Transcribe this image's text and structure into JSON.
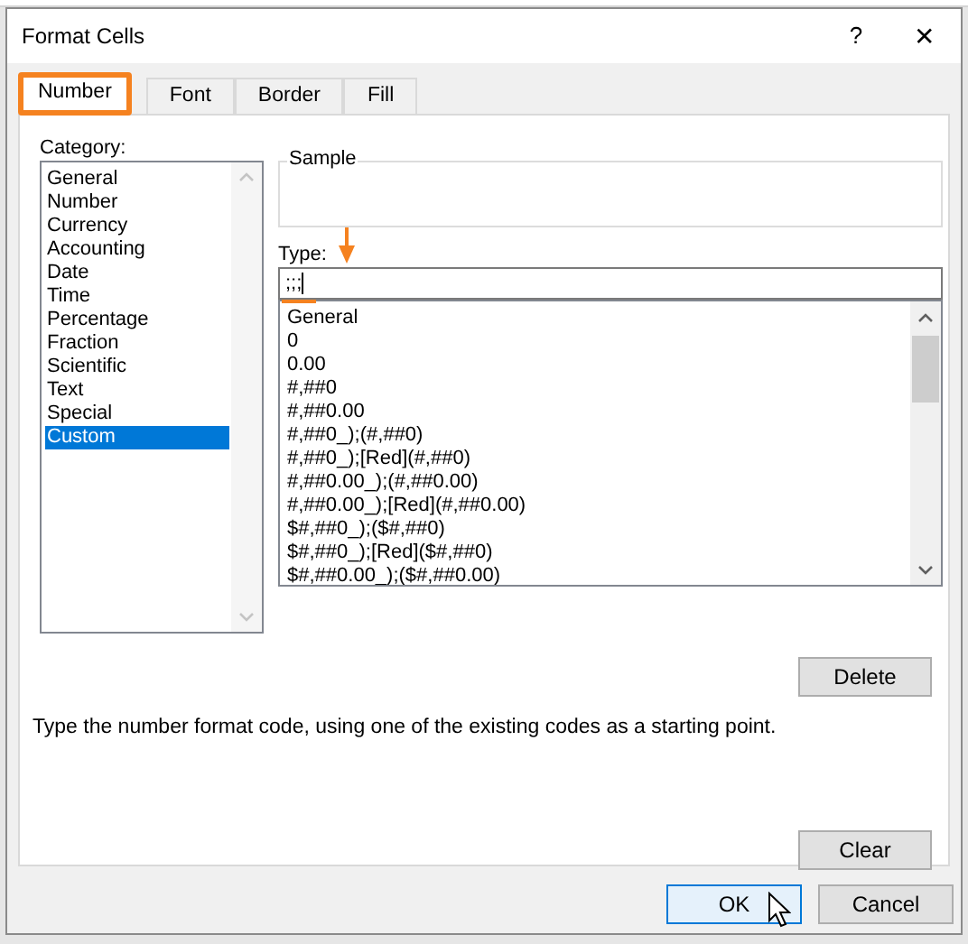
{
  "window": {
    "title": "Format Cells",
    "help": "?",
    "close": "✕"
  },
  "tabs": [
    {
      "label": "Number",
      "selected": true,
      "highlighted": true
    },
    {
      "label": "Font",
      "selected": false,
      "highlighted": false
    },
    {
      "label": "Border",
      "selected": false,
      "highlighted": false
    },
    {
      "label": "Fill",
      "selected": false,
      "highlighted": false
    }
  ],
  "category": {
    "label": "Category:",
    "items": [
      {
        "label": "General",
        "selected": false
      },
      {
        "label": "Number",
        "selected": false
      },
      {
        "label": "Currency",
        "selected": false
      },
      {
        "label": "Accounting",
        "selected": false
      },
      {
        "label": "Date",
        "selected": false
      },
      {
        "label": "Time",
        "selected": false
      },
      {
        "label": "Percentage",
        "selected": false
      },
      {
        "label": "Fraction",
        "selected": false
      },
      {
        "label": "Scientific",
        "selected": false
      },
      {
        "label": "Text",
        "selected": false
      },
      {
        "label": "Special",
        "selected": false
      },
      {
        "label": "Custom",
        "selected": true
      }
    ]
  },
  "sample": {
    "label": "Sample"
  },
  "type": {
    "label": "Type:",
    "value": ";;;",
    "items": [
      "General",
      "0",
      "0.00",
      "#,##0",
      "#,##0.00",
      "#,##0_);(#,##0)",
      "#,##0_);[Red](#,##0)",
      "#,##0.00_);(#,##0.00)",
      "#,##0.00_);[Red](#,##0.00)",
      "$#,##0_);($#,##0)",
      "$#,##0_);[Red]($#,##0)",
      "$#,##0.00_);($#,##0.00)"
    ]
  },
  "delete_button": "Delete",
  "description": "Type the number format code, using one of the existing codes as a starting point.",
  "clear_button": "Clear",
  "buttons": [
    {
      "label": "OK",
      "default": true
    },
    {
      "label": "Cancel",
      "default": false
    }
  ]
}
